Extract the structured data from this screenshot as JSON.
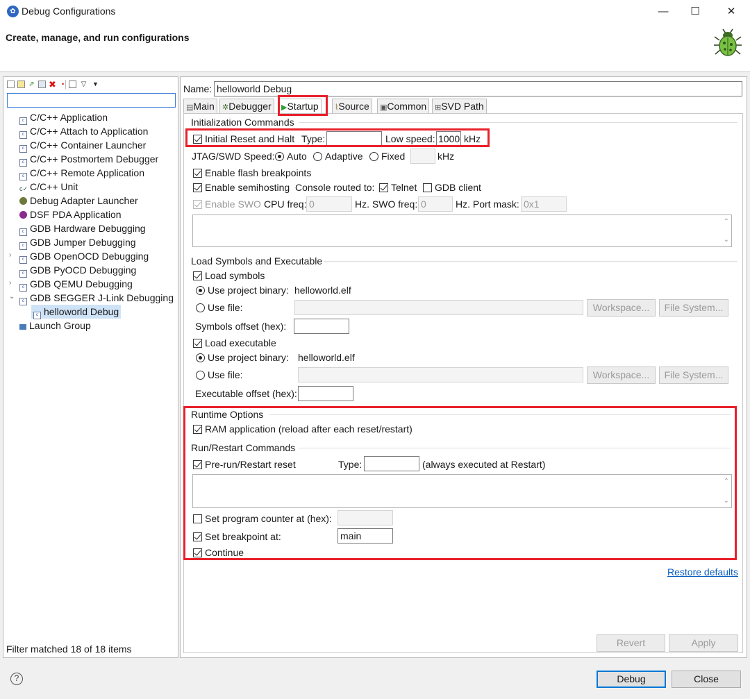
{
  "window": {
    "title": "Debug Configurations",
    "header": "Create, manage, and run configurations"
  },
  "left": {
    "filter_value": "",
    "tree": [
      "C/C++ Application",
      "C/C++ Attach to Application",
      "C/C++ Container Launcher",
      "C/C++ Postmortem Debugger",
      "C/C++ Remote Application",
      "C/C++ Unit",
      "Debug Adapter Launcher",
      "DSF PDA Application",
      "GDB Hardware Debugging",
      "GDB Jumper Debugging",
      "GDB OpenOCD Debugging",
      "GDB PyOCD Debugging",
      "GDB QEMU Debugging",
      "GDB SEGGER J-Link Debugging",
      "helloworld Debug",
      "Launch Group"
    ],
    "filter_status": "Filter matched 18 of 18 items"
  },
  "config": {
    "name_label": "Name:",
    "name_value": "helloworld Debug",
    "tabs": [
      "Main",
      "Debugger",
      "Startup",
      "Source",
      "Common",
      "SVD Path"
    ],
    "init": {
      "title": "Initialization Commands",
      "reset_halt": "Initial Reset and Halt",
      "type_label": "Type:",
      "type_value": "",
      "low_speed_label": "Low speed:",
      "low_speed_value": "1000",
      "khz": "kHz",
      "jtag_label": "JTAG/SWD Speed:",
      "auto": "Auto",
      "adaptive": "Adaptive",
      "fixed": "Fixed",
      "fixed_value": "",
      "flash_bp": "Enable flash breakpoints",
      "semihosting": "Enable semihosting",
      "console_label": "Console routed to:",
      "telnet": "Telnet",
      "gdb_client": "GDB client",
      "swo": "Enable SWO",
      "cpu_freq_label": "CPU freq:",
      "cpu_freq_value": "0",
      "swo_freq_label": "Hz. SWO freq:",
      "swo_freq_value": "0",
      "port_mask_label": "Hz. Port mask:",
      "port_mask_value": "0x1"
    },
    "load": {
      "title": "Load Symbols and Executable",
      "load_symbols": "Load symbols",
      "use_project_binary": "Use project binary:",
      "binary_value": "helloworld.elf",
      "use_file": "Use file:",
      "workspace": "Workspace...",
      "file_system": "File System...",
      "symbols_offset": "Symbols offset (hex):",
      "load_executable": "Load executable",
      "exec_offset": "Executable offset (hex):"
    },
    "runtime": {
      "title": "Runtime Options",
      "ram_app": "RAM application (reload after each reset/restart)"
    },
    "run": {
      "title": "Run/Restart Commands",
      "pre_run": "Pre-run/Restart reset",
      "type_label": "Type:",
      "type_value": "",
      "always": "(always executed at Restart)",
      "set_pc": "Set program counter at (hex):",
      "set_bp": "Set breakpoint at:",
      "bp_value": "main",
      "continue": "Continue"
    },
    "restore_defaults": "Restore defaults",
    "revert": "Revert",
    "apply": "Apply"
  },
  "footer": {
    "help": "?",
    "debug": "Debug",
    "close": "Close"
  },
  "colors": {
    "highlight": "#e8202a",
    "link": "#0b5fbf",
    "selection": "#cfe3f7",
    "startup_icon": "#2e9e3a"
  }
}
